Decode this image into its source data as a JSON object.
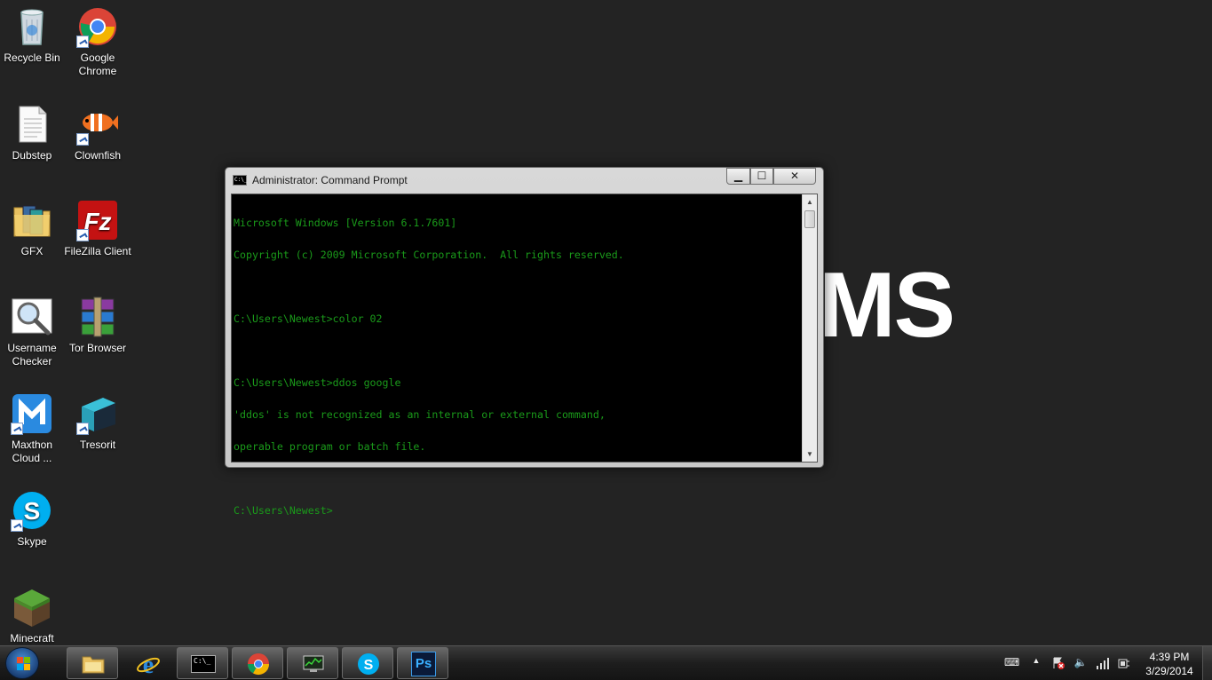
{
  "desktop": {
    "wallpaper_text": "MS",
    "icons": [
      {
        "label": "Recycle Bin",
        "icon": "recycle-bin-icon"
      },
      {
        "label": "Google Chrome",
        "icon": "chrome-icon"
      },
      {
        "label": "Dubstep",
        "icon": "text-file-icon"
      },
      {
        "label": "Clownfish",
        "icon": "clownfish-icon"
      },
      {
        "label": "GFX",
        "icon": "folder-icon"
      },
      {
        "label": "FileZilla Client",
        "icon": "filezilla-icon"
      },
      {
        "label": "Username Checker",
        "icon": "magnifier-icon"
      },
      {
        "label": "Tor Browser",
        "icon": "winrar-icon"
      },
      {
        "label": "Maxthon Cloud ...",
        "icon": "maxthon-icon"
      },
      {
        "label": "Tresorit",
        "icon": "tresorit-icon"
      },
      {
        "label": "Skype",
        "icon": "skype-icon"
      },
      {
        "label": "Minecraft",
        "icon": "minecraft-icon"
      }
    ]
  },
  "cmd_window": {
    "title": "Administrator: Command Prompt",
    "icon_text": "C:\\_",
    "minimize": "▁",
    "maximize": "☐",
    "close": "✕",
    "lines": [
      "Microsoft Windows [Version 6.1.7601]",
      "Copyright (c) 2009 Microsoft Corporation.  All rights reserved.",
      "",
      "C:\\Users\\Newest>color 02",
      "",
      "C:\\Users\\Newest>ddos google",
      "'ddos' is not recognized as an internal or external command,",
      "operable program or batch file.",
      "",
      "C:\\Users\\Newest>"
    ],
    "text_color": "#1a9a1a"
  },
  "taskbar": {
    "apps": [
      {
        "icon": "explorer-folder-icon"
      },
      {
        "icon": "internet-explorer-icon"
      },
      {
        "icon": "command-prompt-icon",
        "text": "C:\\_"
      },
      {
        "icon": "chrome-icon"
      },
      {
        "icon": "network-monitor-icon"
      },
      {
        "icon": "skype-icon"
      },
      {
        "icon": "photoshop-icon",
        "text": "Ps"
      }
    ],
    "tray_icons": [
      "keyboard-icon",
      "show-hidden-icons-icon",
      "action-center-icon",
      "volume-icon",
      "signal-icon",
      "power-icon"
    ],
    "time": "4:39 PM",
    "date": "3/29/2014"
  }
}
